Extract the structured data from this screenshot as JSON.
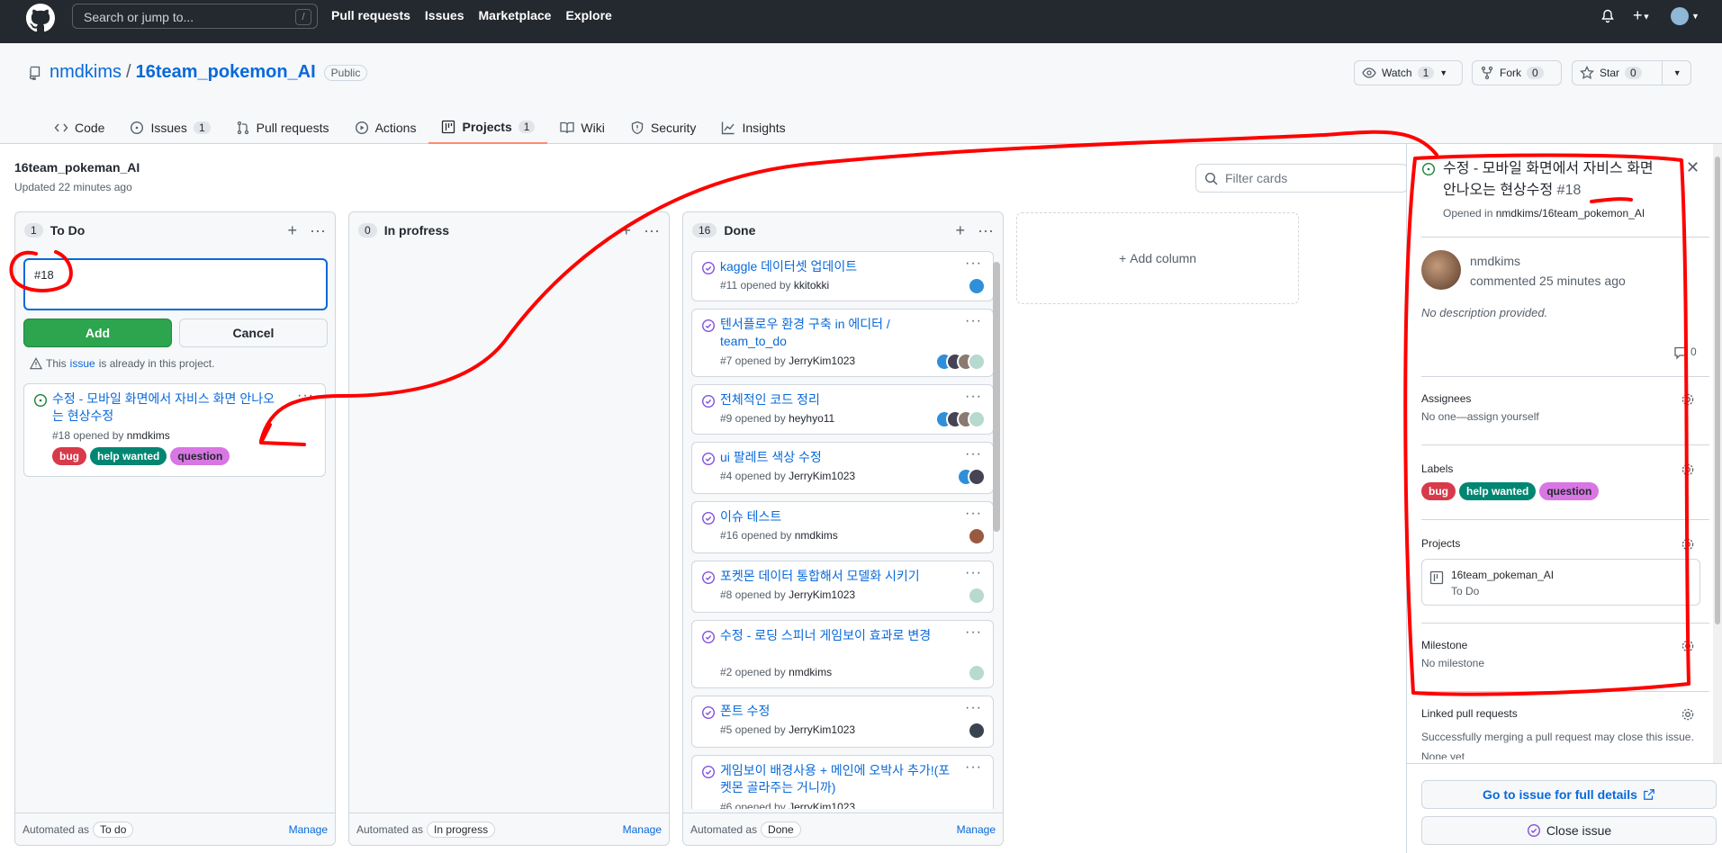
{
  "topbar": {
    "search_placeholder": "Search or jump to...",
    "slash_key": "/",
    "nav": [
      "Pull requests",
      "Issues",
      "Marketplace",
      "Explore"
    ]
  },
  "repo": {
    "owner": "nmdkims",
    "separator": "/",
    "name": "16team_pokemon_AI",
    "visibility": "Public",
    "watch_label": "Watch",
    "watch_count": "1",
    "fork_label": "Fork",
    "fork_count": "0",
    "star_label": "Star",
    "star_count": "0"
  },
  "tabs": [
    {
      "label": "Code",
      "icon": "code-icon"
    },
    {
      "label": "Issues",
      "count": "1",
      "icon": "issue-icon"
    },
    {
      "label": "Pull requests",
      "icon": "pull-request-icon"
    },
    {
      "label": "Actions",
      "icon": "play-icon"
    },
    {
      "label": "Projects",
      "count": "1",
      "icon": "project-icon",
      "selected": true
    },
    {
      "label": "Wiki",
      "icon": "book-icon"
    },
    {
      "label": "Security",
      "icon": "shield-icon"
    },
    {
      "label": "Insights",
      "icon": "graph-icon"
    }
  ],
  "project": {
    "name": "16team_pokeman_AI",
    "updated": "Updated 22 minutes ago",
    "filter_placeholder": "Filter cards",
    "add_column": "Add column"
  },
  "columns": [
    {
      "count": "1",
      "title": "To Do",
      "automated_prefix": "Automated as",
      "automated_value": "To do",
      "manage": "Manage",
      "note_value": "#18",
      "add_label": "Add",
      "cancel_label": "Cancel",
      "warning_pre": "This",
      "warning_link": "issue",
      "warning_post": "is already in this project.",
      "card": {
        "title": "수정 - 모바일 화면에서 자비스 화면 안나오는 현상수정",
        "meta_pre": "#18 opened by",
        "meta_user": "nmdkims",
        "labels": [
          {
            "name": "bug",
            "color": "#d73a4a"
          },
          {
            "name": "help wanted",
            "color": "#008672"
          },
          {
            "name": "question",
            "color": "#d876e3"
          }
        ]
      }
    },
    {
      "count": "0",
      "title": "In profress",
      "automated_prefix": "Automated as",
      "automated_value": "In progress",
      "manage": "Manage"
    },
    {
      "count": "16",
      "title": "Done",
      "automated_prefix": "Automated as",
      "automated_value": "Done",
      "manage": "Manage",
      "cards": [
        {
          "title": "kaggle 데이터셋 업데이트",
          "meta_pre": "#11 opened by",
          "meta_user": "kkitokki"
        },
        {
          "title": "텐서플로우 환경 구축 in 에디터 / team_to_do",
          "meta_pre": "#7 opened by",
          "meta_user": "JerryKim1023"
        },
        {
          "title": "전체적인 코드 정리",
          "meta_pre": "#9 opened by",
          "meta_user": "heyhyo11"
        },
        {
          "title": "ui 팔레트 색상 수정",
          "meta_pre": "#4 opened by",
          "meta_user": "JerryKim1023"
        },
        {
          "title": "이슈 테스트",
          "meta_pre": "#16 opened by",
          "meta_user": "nmdkims"
        },
        {
          "title": "포켓몬 데이터 통합해서 모델화 시키기",
          "meta_pre": "#8 opened by",
          "meta_user": "JerryKim1023"
        },
        {
          "title": "수정 - 로딩 스피너 게임보이 효과로 변경",
          "meta_pre": "#2 opened by",
          "meta_user": "nmdkims"
        },
        {
          "title": "폰트 수정",
          "meta_pre": "#5 opened by",
          "meta_user": "JerryKim1023"
        },
        {
          "title": "게임보이 배경사용 + 메인에 오박사 추가!(포켓몬 골라주는 거니까)",
          "meta_pre": "#6 opened by",
          "meta_user": "JerryKim1023"
        }
      ]
    }
  ],
  "panel": {
    "title": "수정 - 모바일 화면에서 자비스 화면 안나오는 현상수정",
    "number": "#18",
    "opened_in_pre": "Opened in",
    "opened_in_repo": "nmdkims/16team_pokemon_AI",
    "author": "nmdkims",
    "commented": "commented 25 minutes ago",
    "description": "No description provided.",
    "comment_count": "0",
    "assignees_title": "Assignees",
    "assignees_value": "No one—assign yourself",
    "labels_title": "Labels",
    "projects_title": "Projects",
    "project_name": "16team_pokeman_AI",
    "project_column": "To Do",
    "milestone_title": "Milestone",
    "milestone_value": "No milestone",
    "linked_title": "Linked pull requests",
    "linked_desc": "Successfully merging a pull request may close this issue.",
    "linked_none": "None yet",
    "go_to_issue": "Go to issue for full details",
    "close_issue": "Close issue"
  },
  "colors": {
    "topbar": "#24292f",
    "link": "#0969da",
    "green": "#2da44e",
    "annotation": "#ff0000",
    "issue_open": "#1a7f37",
    "issue_closed": "#8250df"
  }
}
